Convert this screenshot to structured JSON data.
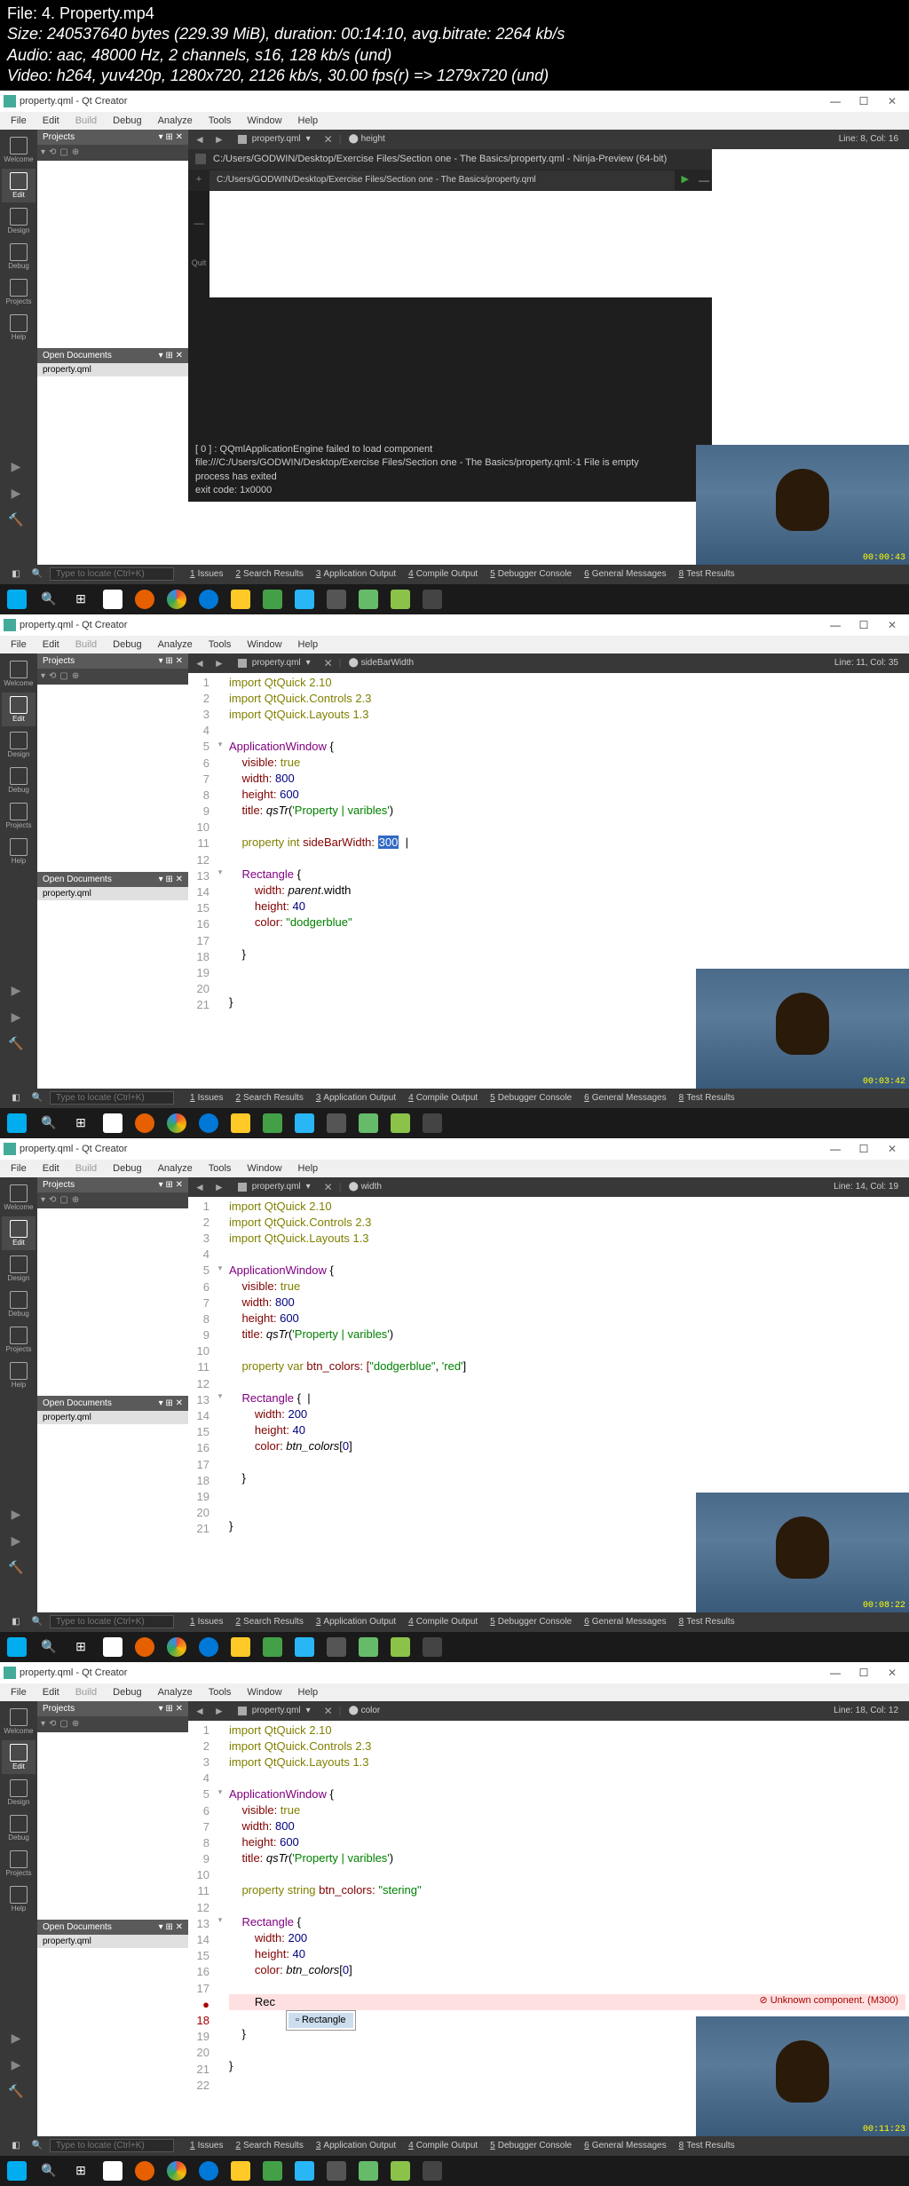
{
  "media": {
    "file": "File: 4. Property.mp4",
    "size": "Size: 240537640 bytes (229.39 MiB), duration: 00:14:10, avg.bitrate: 2264 kb/s",
    "audio": "Audio: aac, 48000 Hz, 2 channels, s16, 128 kb/s (und)",
    "video": "Video: h264, yuv420p, 1280x720, 2126 kb/s, 30.00 fps(r) => 1279x720 (und)"
  },
  "title": "property.qml - Qt Creator",
  "menu": [
    "File",
    "Edit",
    "Build",
    "Debug",
    "Analyze",
    "Tools",
    "Window",
    "Help"
  ],
  "sidebar": [
    "Welcome",
    "Edit",
    "Design",
    "Debug",
    "Projects",
    "Help"
  ],
  "panels": {
    "projects": "Projects",
    "docs": "Open Documents"
  },
  "file": "property.qml",
  "tabFile": "property.qml",
  "search_ph": "Type to locate (Ctrl+K)",
  "bottom": [
    {
      "n": "1",
      "l": "Issues"
    },
    {
      "n": "2",
      "l": "Search Results"
    },
    {
      "n": "3",
      "l": "Application Output"
    },
    {
      "n": "4",
      "l": "Compile Output"
    },
    {
      "n": "5",
      "l": "Debugger Console"
    },
    {
      "n": "6",
      "l": "General Messages"
    },
    {
      "n": "8",
      "l": "Test Results"
    }
  ],
  "f1": {
    "crumb": "height",
    "line": "Line: 8, Col: 16",
    "term_title": "C:/Users/GODWIN/Desktop/Exercise Files/Section one - The Basics/property.qml  -  Ninja-Preview (64-bit)",
    "term_tab": "C:/Users/GODWIN/Desktop/Exercise Files/Section one - The Basics/property.qml",
    "quit": "Quit",
    "out": [
      "[ 0 ] : QQmlApplicationEngine failed to load component",
      "file:///C:/Users/GODWIN/Desktop/Exercise Files/Section one - The Basics/property.qml:-1 File is empty",
      "",
      "process has exited",
      "exit code: 1x0000"
    ],
    "ts": "00:00:43"
  },
  "f2": {
    "crumb": "sideBarWidth",
    "line": "Line: 11, Col: 35",
    "code": {
      "l1": "import QtQuick 2.10",
      "l2": "import QtQuick.Controls 2.3",
      "l3": "import QtQuick.Layouts 1.3",
      "l5a": "ApplicationWindow",
      "l5b": " {",
      "l6a": "    visible: ",
      "l6b": "true",
      "l7a": "    width: ",
      "l7b": "800",
      "l8a": "    height: ",
      "l8b": "600",
      "l9a": "    title: ",
      "l9b": "qsTr",
      "l9c": "(",
      "l9d": "'Property | varibles'",
      "l9e": ")",
      "l11a": "    property",
      "l11b": " int",
      "l11c": " sideBarWidth: ",
      "l11d": "300",
      "l13a": "    Rectangle",
      "l13b": " {",
      "l14a": "        width: ",
      "l14b": "parent",
      "l14c": ".width",
      "l15a": "        height: ",
      "l15b": "40",
      "l16a": "        color: ",
      "l16b": "\"dodgerblue\"",
      "l18": "    }",
      "l21": "}"
    },
    "ts": "00:03:42"
  },
  "f3": {
    "crumb": "width",
    "line": "Line: 14, Col: 19",
    "code": {
      "l1": "import QtQuick 2.10",
      "l2": "import QtQuick.Controls 2.3",
      "l3": "import QtQuick.Layouts 1.3",
      "l5a": "ApplicationWindow",
      "l5b": " {",
      "l6a": "    visible: ",
      "l6b": "true",
      "l7a": "    width: ",
      "l7b": "800",
      "l8a": "    height: ",
      "l8b": "600",
      "l9a": "    title: ",
      "l9b": "qsTr",
      "l9c": "(",
      "l9d": "'Property | varibles'",
      "l9e": ")",
      "l11a": "    property",
      "l11b": " var",
      "l11c": " btn_colors: [",
      "l11d": "\"dodgerblue\"",
      "l11e": ", ",
      "l11f": "'red'",
      "l11g": "]",
      "l13a": "    Rectangle",
      "l13b": " {",
      "l14a": "        width: ",
      "l14b": "200",
      "l15a": "        height: ",
      "l15b": "40",
      "l16a": "        color: ",
      "l16b": "btn_colors",
      "l16c": "[",
      "l16d": "0",
      "l16e": "]",
      "l18": "    }",
      "l21": "}"
    },
    "ts": "00:08:22"
  },
  "f4": {
    "crumb": "color",
    "line": "Line: 18, Col: 12",
    "code": {
      "l1": "import QtQuick 2.10",
      "l2": "import QtQuick.Controls 2.3",
      "l3": "import QtQuick.Layouts 1.3",
      "l5a": "ApplicationWindow",
      "l5b": " {",
      "l6a": "    visible: ",
      "l6b": "true",
      "l7a": "    width: ",
      "l7b": "800",
      "l8a": "    height: ",
      "l8b": "600",
      "l9a": "    title: ",
      "l9b": "qsTr",
      "l9c": "(",
      "l9d": "'Property | varibles'",
      "l9e": ")",
      "l11a": "    property",
      "l11b": " string",
      "l11c": " btn_colors: ",
      "l11d": "\"stering\"",
      "l13a": "    Rectangle",
      "l13b": " {",
      "l14a": "        width: ",
      "l14b": "200",
      "l15a": "        height: ",
      "l15b": "40",
      "l16a": "        color: ",
      "l16b": "btn_colors",
      "l16c": "[",
      "l16d": "0",
      "l16e": "]",
      "l18": "        Rec",
      "l19": "Rectangle",
      "l20": "    }",
      "l22": "}",
      "err": "Unknown component. (M300)"
    },
    "ts": "00:11:23"
  }
}
